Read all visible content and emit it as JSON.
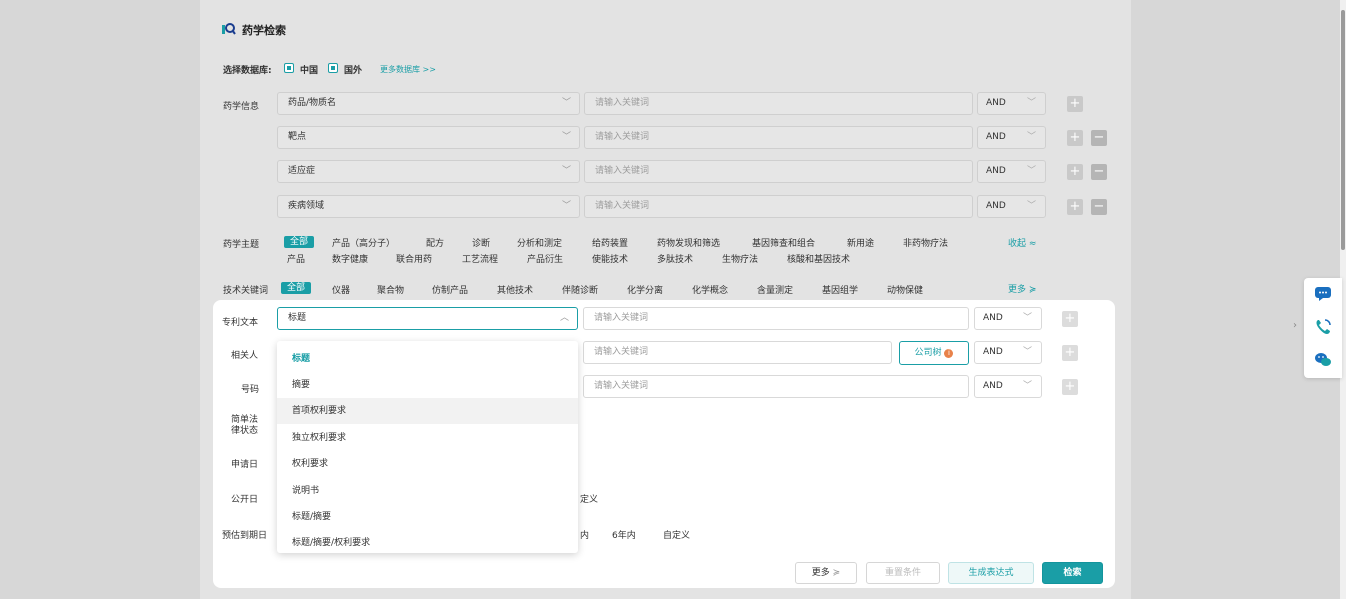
{
  "header": {
    "title": "药学检索"
  },
  "database": {
    "label": "选择数据库:",
    "options": [
      "中国",
      "国外"
    ],
    "more_link": "更多数据库 >>"
  },
  "pharma_info": {
    "label": "药学信息",
    "rows": [
      {
        "field": "药品/物质名",
        "placeholder": "请输入关键词",
        "op": "AND"
      },
      {
        "field": "靶点",
        "placeholder": "请输入关键词",
        "op": "AND"
      },
      {
        "field": "适应症",
        "placeholder": "请输入关键词",
        "op": "AND"
      },
      {
        "field": "疾病领域",
        "placeholder": "请输入关键词",
        "op": "AND"
      }
    ]
  },
  "topics": {
    "label": "药学主题",
    "selected": "全部",
    "line1": [
      "产品（高分子）",
      "配方",
      "诊断",
      "分析和测定",
      "给药装置",
      "药物发现和筛选",
      "基因筛查和组合",
      "新用途",
      "非药物疗法"
    ],
    "line2": [
      "产品",
      "数字健康",
      "联合用药",
      "工艺流程",
      "产品衍生",
      "使能技术",
      "多肽技术",
      "生物疗法",
      "核酸和基因技术"
    ],
    "collapse": "收起 ≈"
  },
  "tech": {
    "label": "技术关键词",
    "selected": "全部",
    "items": [
      "仪器",
      "聚合物",
      "仿制产品",
      "其他技术",
      "伴随诊断",
      "化学分离",
      "化学概念",
      "含量测定",
      "基因组学",
      "动物保健"
    ],
    "more": "更多 ≽"
  },
  "patent": {
    "rows": [
      {
        "label": "专利文本",
        "field": "标题",
        "placeholder": "请输入关键词",
        "op": "AND"
      },
      {
        "label": "相关人",
        "placeholder": "请输入关键词",
        "op": "AND",
        "extra": "公司树"
      },
      {
        "label": "号码",
        "placeholder": "请输入关键词",
        "op": "AND"
      }
    ],
    "legal_status": "简单法律状态",
    "apply_date": "申请日",
    "pub_date": "公开日",
    "pub_tail": "定义",
    "expire": "预估到期日",
    "expire_opts": [
      "内",
      "6年内",
      "自定义"
    ]
  },
  "dropdown": {
    "items": [
      "标题",
      "摘要",
      "首项权利要求",
      "独立权利要求",
      "权利要求",
      "说明书",
      "标题/摘要",
      "标题/摘要/权利要求"
    ]
  },
  "footer": {
    "more": "更多",
    "reset": "重置条件",
    "generate": "生成表达式",
    "search": "检索"
  },
  "colors": {
    "accent": "#1a9ea6",
    "accent_dark": "#13949c",
    "badge": "#e8824a"
  }
}
